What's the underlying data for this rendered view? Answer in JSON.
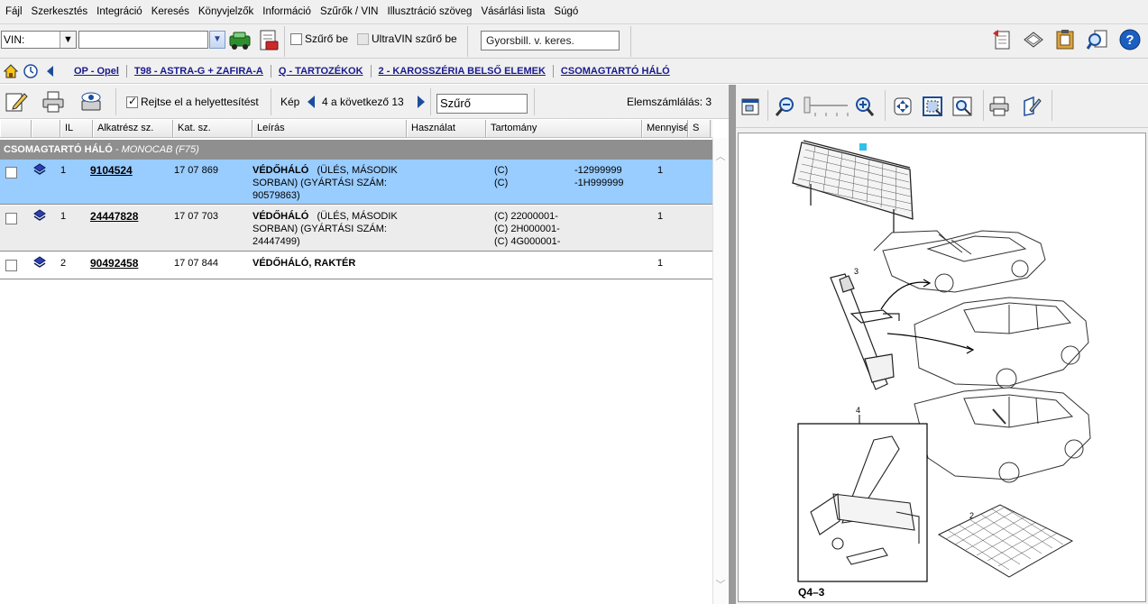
{
  "menu": [
    "Fájl",
    "Szerkesztés",
    "Integráció",
    "Keresés",
    "Könyvjelzők",
    "Információ",
    "Szűrők / VIN",
    "Illusztráció szöveg",
    "Vásárlási lista",
    "Súgó"
  ],
  "toolbar": {
    "vin_label": "VIN:",
    "vin_value": "",
    "filter_on_label": "Szűrő be",
    "ultravin_label": "UltraVIN szűrő be",
    "quick_search_placeholder": "Gyorsbill. v. keres."
  },
  "breadcrumb": [
    "OP - Opel",
    "T98 - ASTRA-G + ZAFIRA-A",
    "Q - TARTOZÉKOK",
    "2 - KAROSSZÉRIA BELSŐ ELEMEK",
    "CSOMAGTARTÓ HÁLÓ"
  ],
  "list_toolbar": {
    "hide_replacements_label": "Rejtse el a helyettesítést",
    "image_label": "Kép",
    "image_counter": "4 a következő 13",
    "filter_value": "Szűrő",
    "element_count": "Elemszámlálás: 3"
  },
  "columns": [
    "",
    "",
    "IL",
    "Alkatrész sz.",
    "Kat. sz.",
    "Leírás",
    "Használat",
    "Tartomány",
    "Mennyisé",
    "S"
  ],
  "group": {
    "title": "CSOMAGTARTÓ HÁLÓ",
    "subtitle": " - MONOCAB (F75)"
  },
  "rows": [
    {
      "il": "1",
      "part_no": "9104524",
      "cat_no": "17 07 869",
      "desc_bold": "VÉDŐHÁLÓ",
      "desc_rest": "(ÜLÉS, MÁSODIK SORBAN) (GYÁRTÁSI SZÁM: 90579863)",
      "range1": "(C)\n(C)",
      "range2": "-12999999\n-1H999999",
      "qty": "1",
      "selected": true
    },
    {
      "il": "1",
      "part_no": "24447828",
      "cat_no": "17 07 703",
      "desc_bold": "VÉDŐHÁLÓ",
      "desc_rest": "(ÜLÉS, MÁSODIK SORBAN) (GYÁRTÁSI SZÁM: 24447499)",
      "range1": "(C) 22000001-\n(C) 2H000001-\n(C) 4G000001-",
      "range2": "",
      "qty": "1",
      "selected": false
    },
    {
      "il": "2",
      "part_no": "90492458",
      "cat_no": "17 07 844",
      "desc_bold": "VÉDŐHÁLÓ, RAKTÉR",
      "desc_rest": "",
      "range1": "",
      "range2": "",
      "qty": "1",
      "selected": false
    }
  ],
  "illustration": {
    "callouts": [
      "3",
      "4",
      "2"
    ],
    "code": "Q4–3"
  },
  "colors": {
    "selected_row": "#99ccff",
    "alt_row": "#ececec",
    "group_header": "#8f8f8f",
    "link": "#1a1a8c"
  }
}
